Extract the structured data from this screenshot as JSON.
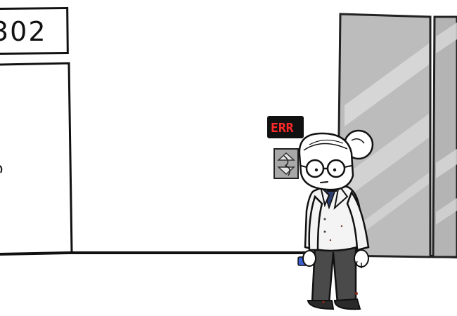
{
  "scene": {
    "room_sign": {
      "text": "302"
    },
    "elevator_display": {
      "text": "ERR",
      "text_color": "#ff2a2a",
      "bg_color": "#111111"
    },
    "elevator_call_panel": {
      "state": "broken"
    },
    "character": {
      "pose": "slouching",
      "holding": "blue-object"
    }
  },
  "colors": {
    "wall": "#ffffff",
    "floor_line": "#111111",
    "elevator_door": "#b9b9b9",
    "coat": "#f2f2f2",
    "shirt": "#2c3e6e",
    "pants": "#4a4a4a",
    "shoes": "#2a2a2a"
  }
}
